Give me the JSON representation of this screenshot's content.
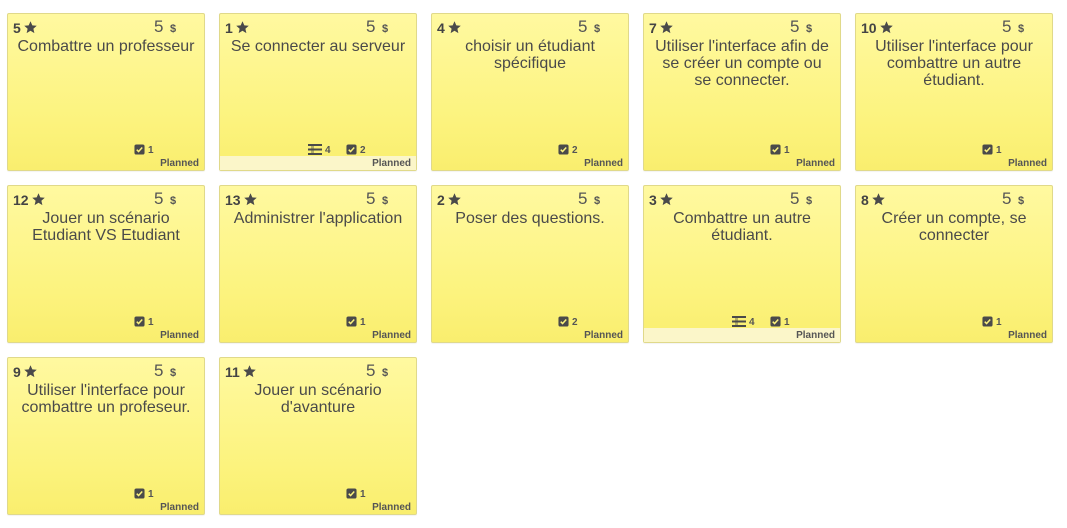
{
  "status_label": "Planned",
  "points_label": "5",
  "currency_label": "$",
  "colors": {
    "card": "#fcf37d",
    "footer_light": "#fbf6c9",
    "text": "#4a4a4a"
  },
  "cards": [
    {
      "id": "5",
      "title": "Combattre un professeur",
      "tasks": "1"
    },
    {
      "id": "1",
      "title": "Se connecter au serveur",
      "tasks": "2",
      "subtasks": "4"
    },
    {
      "id": "4",
      "title": "choisir un étudiant spécifique",
      "tasks": "2"
    },
    {
      "id": "7",
      "title": "Utiliser l'interface afin de se créer un compte ou se connecter.",
      "tasks": "1"
    },
    {
      "id": "10",
      "title": "Utiliser l'interface pour combattre un autre étudiant.",
      "tasks": "1"
    },
    {
      "id": "12",
      "title": "Jouer un scénario Etudiant VS Etudiant",
      "tasks": "1"
    },
    {
      "id": "13",
      "title": "Administrer l'application",
      "tasks": "1"
    },
    {
      "id": "2",
      "title": "Poser des questions.",
      "tasks": "2"
    },
    {
      "id": "3",
      "title": "Combattre un autre étudiant.",
      "tasks": "1",
      "subtasks": "4"
    },
    {
      "id": "8",
      "title": "Créer un compte, se connecter",
      "tasks": "1"
    },
    {
      "id": "9",
      "title": "Utiliser l'interface pour combattre un profeseur.",
      "tasks": "1"
    },
    {
      "id": "11",
      "title": "Jouer un scénario d'avanture",
      "tasks": "1"
    }
  ]
}
